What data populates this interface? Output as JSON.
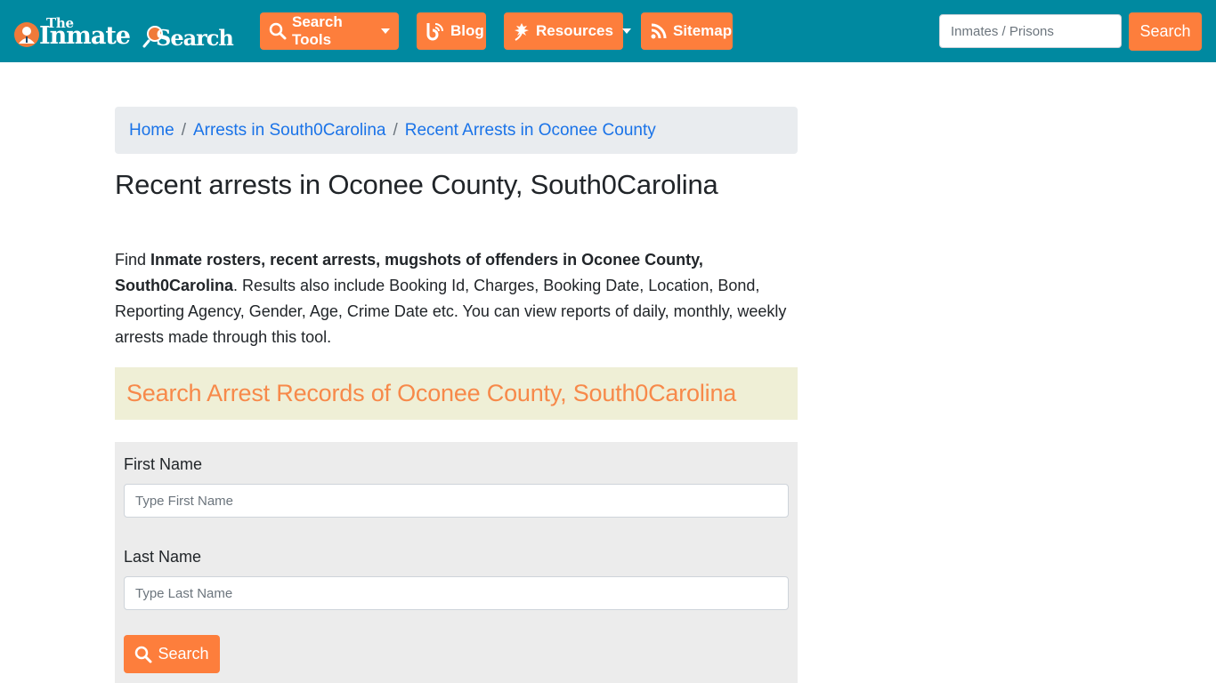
{
  "brand": {
    "logo_the": "The",
    "logo_inmate": "Inmate",
    "logo_search": "Search",
    "colors": {
      "navbar": "#0089a0",
      "accent": "#fd7e3c",
      "breadcrumb_bg": "#e9ecef",
      "link": "#1a73e8",
      "heading_box_bg": "#efefd6",
      "heading_box_text": "#f7894a",
      "form_bg": "#ececec"
    }
  },
  "nav": {
    "items": [
      {
        "label": "Search Tools",
        "icon": "search-icon",
        "dropdown": true
      },
      {
        "label": "Blog",
        "icon": "blog-feed-icon",
        "dropdown": false
      },
      {
        "label": "Resources",
        "icon": "leaf-icon",
        "dropdown": true
      },
      {
        "label": "Sitemap",
        "icon": "rss-icon",
        "dropdown": false
      }
    ],
    "search": {
      "placeholder": "Inmates / Prisons",
      "value": "",
      "button_label": "Search"
    }
  },
  "breadcrumb": {
    "items": [
      {
        "label": "Home"
      },
      {
        "label": "Arrests in South0Carolina"
      },
      {
        "label": "Recent Arrests in Oconee County"
      }
    ],
    "separator": "/"
  },
  "main": {
    "title": "Recent arrests in Oconee County, South0Carolina",
    "intro": {
      "prefix": "Find ",
      "bold": "Inmate rosters, recent arrests, mugshots of offenders in Oconee County, South0Carolina",
      "suffix": ". Results also include Booking Id, Charges, Booking Date, Location, Bond, Reporting Agency, Gender, Age, Crime Date etc. You can view reports of daily, monthly, weekly arrests made through this tool."
    },
    "search_heading": "Search Arrest Records of Oconee County, South0Carolina",
    "form": {
      "first_name_label": "First Name",
      "first_name_placeholder": "Type First Name",
      "first_name_value": "",
      "last_name_label": "Last Name",
      "last_name_placeholder": "Type Last Name",
      "last_name_value": "",
      "submit_label": "Search"
    }
  }
}
